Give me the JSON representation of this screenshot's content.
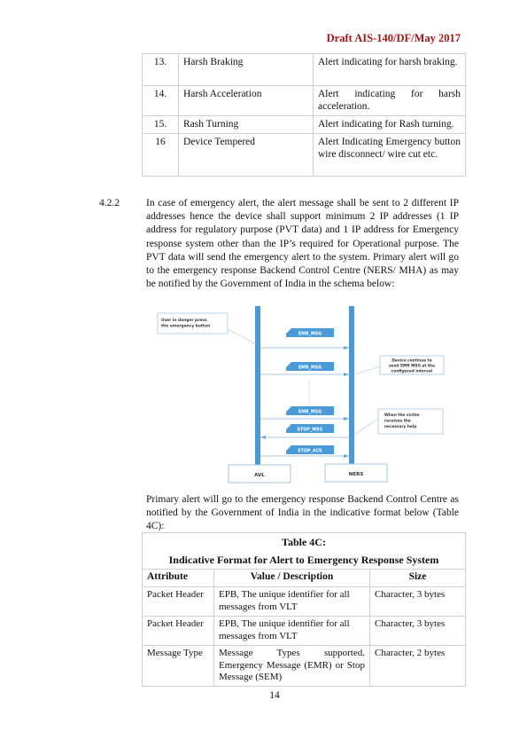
{
  "header": {
    "title": "Draft AIS-140/DF/May 2017"
  },
  "alert_table": {
    "rows": [
      {
        "no": "13.",
        "name": "Harsh Braking",
        "description": "Alert indicating for harsh braking."
      },
      {
        "no": "14.",
        "name": "Harsh Acceleration",
        "description": "Alert indicating for harsh acceleration."
      },
      {
        "no": "15.",
        "name": "Rash Turning",
        "description": "Alert indicating for Rash turning."
      },
      {
        "no": "16",
        "name": "Device Tempered",
        "description": "Alert Indicating Emergency button wire disconnect/ wire cut etc."
      }
    ]
  },
  "section": {
    "number": "4.2.2",
    "text": "In case of emergency alert, the alert message shall be sent to 2 different IP addresses hence the device shall support minimum 2 IP addresses (1 IP address for regulatory purpose (PVT data) and 1 IP address for Emergency response system other than the IP’s required for Operational purpose. The PVT data will send the emergency alert to the system. Primary alert will go to the emergency response Backend Control Centre (NERS/ MHA) as may be notified by the Government of India in the schema below:"
  },
  "diagram": {
    "colors": {
      "lifeline": "#4a9ad8",
      "tag": "#4a9ad8",
      "arrow": "#8fb8dc",
      "box_border": "#a9c6df"
    },
    "lifelines": [
      {
        "label": "AVL"
      },
      {
        "label": "NERS"
      }
    ],
    "messages": [
      {
        "label": "EMR_MSG",
        "direction": "AVL-to-NERS"
      },
      {
        "label": "EMR_MSG",
        "direction": "AVL-to-NERS"
      },
      {
        "label": "EMR_MSG",
        "direction": "AVL-to-NERS"
      },
      {
        "label": "STOP_MSG",
        "direction": "NERS-to-AVL"
      },
      {
        "label": "STOP_ACK",
        "direction": "AVL-to-NERS"
      }
    ],
    "notes": [
      {
        "lines": [
          "User in danger press",
          "the emergency button"
        ]
      },
      {
        "lines": [
          "Device continue to",
          "send EMR MSG at the",
          "configured interval"
        ]
      },
      {
        "lines": [
          "When the victim",
          "receives the",
          "necessary help"
        ]
      }
    ]
  },
  "paragraph2": "Primary alert will go to the emergency response Backend Control Centre as notified by the Government of India in the indicative format below (Table 4C):",
  "table_4c": {
    "caption": "Table 4C:",
    "title": "Indicative Format for Alert to Emergency Response System",
    "headers": [
      "Attribute",
      "Value / Description",
      "Size"
    ],
    "rows": [
      [
        "Packet Header",
        "EPB, The unique identifier for all messages from VLT",
        "Character, 3 bytes"
      ],
      [
        "Packet Header",
        "EPB, The unique identifier for all messages from VLT",
        "Character, 3 bytes"
      ],
      [
        "Message Type",
        "Message Types supported. Emergency Message (EMR) or Stop Message (SEM)",
        "Character, 2 bytes"
      ]
    ]
  },
  "page_number": "14"
}
